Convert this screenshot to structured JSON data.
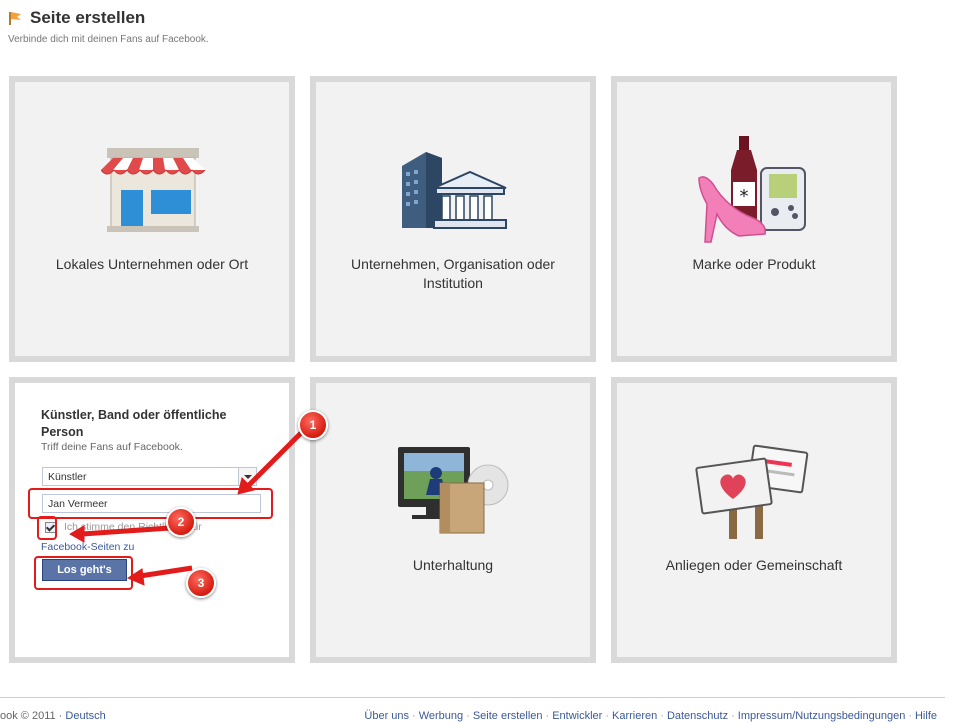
{
  "header": {
    "title": "Seite erstellen",
    "subtitle": "Verbinde dich mit deinen Fans auf Facebook."
  },
  "categories": [
    {
      "label": "Lokales Unternehmen oder Ort",
      "icon": "storefront-icon"
    },
    {
      "label": "Unternehmen, Organisation oder Institution",
      "icon": "buildings-icon"
    },
    {
      "label": "Marke oder Produkt",
      "icon": "products-icon"
    },
    {
      "label": "Unterhaltung",
      "icon": "entertainment-icon"
    },
    {
      "label": "Anliegen oder Gemeinschaft",
      "icon": "cause-signs-icon"
    }
  ],
  "form": {
    "title": "Künstler, Band oder öffentliche Person",
    "subtitle": "Triff deine Fans auf Facebook.",
    "category_selected": "Künstler",
    "name_value": "Jan Vermeer",
    "agree_text": "Ich stimme den Richtlinien für",
    "agree_link": "Facebook-Seiten zu",
    "agree_checked": true,
    "submit_label": "Los geht's"
  },
  "annotations": [
    "1",
    "2",
    "3"
  ],
  "footer": {
    "copyright": "ook © 2011 ·",
    "language": "Deutsch",
    "links": [
      "Über uns",
      "Werbung",
      "Seite erstellen",
      "Entwickler",
      "Karrieren",
      "Datenschutz",
      "Impressum/Nutzungsbedingungen",
      "Hilfe"
    ]
  },
  "colors": {
    "annotation_red": "#e21b1b",
    "link_blue": "#3b5998",
    "button_blue": "#5b74a8"
  }
}
